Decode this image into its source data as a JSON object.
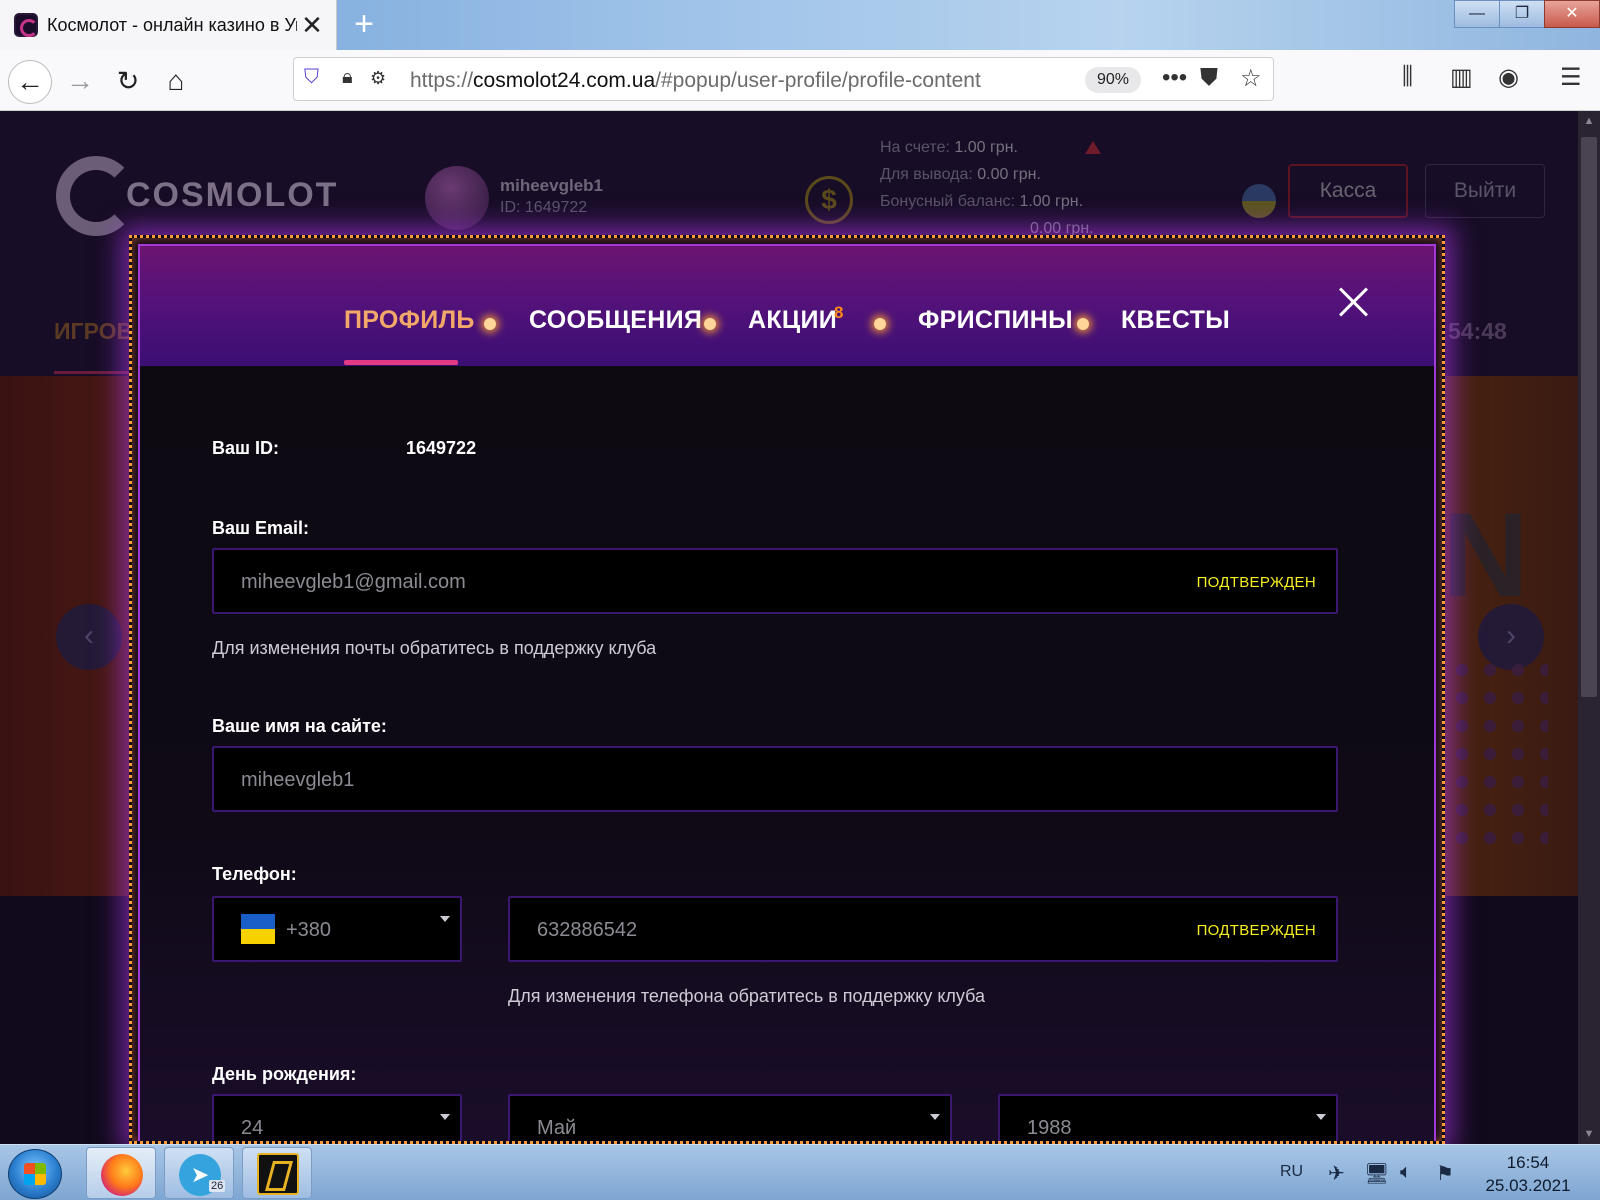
{
  "browser": {
    "tab_title": "Космолот - онлайн казино в Ук",
    "new_tab_icon": "plus-icon",
    "url_scheme": "https://",
    "url_domain": "cosmolot24.com.ua",
    "url_path": "/#popup/user-profile/profile-content",
    "zoom": "90%",
    "window_buttons": [
      "—",
      "❐",
      "✕"
    ]
  },
  "site": {
    "logo_text": "COSMOLOT",
    "username": "miheevgleb1",
    "user_id_label": "ID: 1649722",
    "balance_lines": [
      {
        "label": "На счете:",
        "value": "1.00 грн."
      },
      {
        "label": "Для вывода:",
        "value": "0.00 грн."
      },
      {
        "label": "Бонусный баланс:",
        "value": "1.00 грн."
      },
      {
        "label": "",
        "value": "0.00 грн."
      }
    ],
    "kassa_button": "Касса",
    "exit_button": "Выйти",
    "menu_item": "ИГРОВ",
    "time_fragment": "54:48",
    "banner_letter": "N"
  },
  "modal": {
    "tabs": [
      {
        "label": "ПРОФИЛЬ",
        "active": true
      },
      {
        "label": "СООБЩЕНИЯ",
        "active": false
      },
      {
        "label": "АКЦИИ",
        "active": false,
        "badge": "8"
      },
      {
        "label": "ФРИСПИНЫ",
        "active": false
      },
      {
        "label": "КВЕСТЫ",
        "active": false
      }
    ],
    "id_label": "Ваш ID:",
    "id_value": "1649722",
    "email_label": "Ваш Email:",
    "email_value": "miheevgleb1@gmail.com",
    "email_status": "ПОДТВЕРЖДЕН",
    "email_hint": "Для изменения почты обратитесь в поддержку клуба",
    "name_label": "Ваше имя на сайте:",
    "name_value": "miheevgleb1",
    "phone_label": "Телефон:",
    "phone_code": "+380",
    "phone_value": "632886542",
    "phone_status": "ПОДТВЕРЖДЕН",
    "phone_hint": "Для изменения телефона обратитесь в поддержку клуба",
    "birthday_label": "День рождения:",
    "birthday_day": "24",
    "birthday_month": "Май",
    "birthday_year": "1988"
  },
  "taskbar": {
    "telegram_badge": "26",
    "lang": "RU",
    "time": "16:54",
    "date": "25.03.2021"
  },
  "colors": {
    "accent_tab": "#f2a868",
    "underline": "#e33a86",
    "confirmed": "#f6ee22",
    "field_border": "#3a1870"
  }
}
